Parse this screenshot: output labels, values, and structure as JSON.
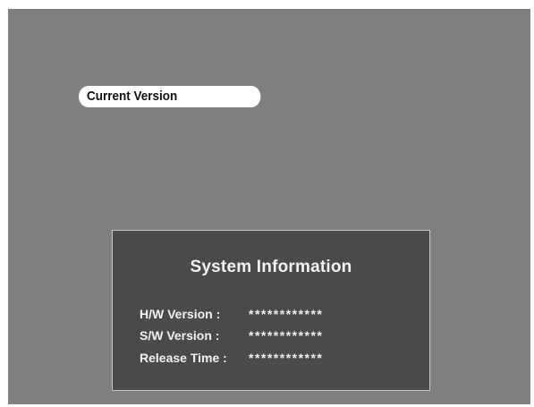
{
  "menu": {
    "current_version_label": "Current Version"
  },
  "system_information": {
    "title": "System Information",
    "rows": [
      {
        "label": "H/W Version :",
        "value": "************"
      },
      {
        "label": "S/W Version :",
        "value": "************"
      },
      {
        "label": "Release Time :",
        "value": "************"
      }
    ]
  },
  "colors": {
    "screen_background": "#808080",
    "panel_background": "#4a4a4a",
    "panel_border": "#c8c8c8",
    "menu_highlight": "#ffffff",
    "text_light": "#f2f2f2",
    "text_dark": "#111111"
  }
}
